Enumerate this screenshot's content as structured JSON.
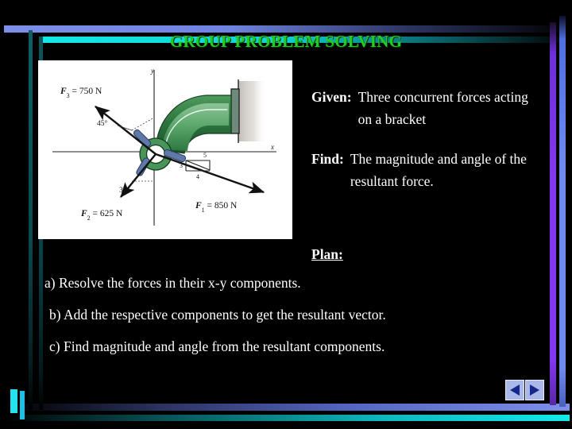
{
  "slide": {
    "title": "GROUP PROBLEM SOLVING",
    "title_color": "#22cc22",
    "background_color": "#000000",
    "text_color": "#ffffff"
  },
  "given": {
    "label": "Given:",
    "text": "Three concurrent forces  acting on a bracket"
  },
  "find": {
    "label": "Find:",
    "text": "The magnitude and angle of the resultant force."
  },
  "plan": {
    "heading": "Plan:",
    "items": [
      "a) Resolve the forces in their x-y components.",
      "b) Add the respective components to get the resultant vector.",
      "c) Find magnitude and angle from the resultant components."
    ]
  },
  "figure": {
    "axis_x_label": "x",
    "axis_y_label": "y",
    "forces": [
      {
        "name": "F_1",
        "label": "F",
        "sub": "1",
        "value": "= 850 N",
        "full": "F₁ = 850 N"
      },
      {
        "name": "F_2",
        "label": "F",
        "sub": "2",
        "value": "= 625 N",
        "full": "F₂ = 625 N"
      },
      {
        "name": "F_3",
        "label": "F",
        "sub": "3",
        "value": "= 750 N",
        "full": "F₃ = 750 N"
      }
    ],
    "angles": [
      "45°",
      "30°"
    ],
    "slope_triangle": {
      "rise": "3",
      "run": "4",
      "hyp": "5"
    },
    "bracket_color": "#3f8a4e"
  },
  "nav": {
    "previous_label": "previous-slide",
    "next_label": "next-slide"
  },
  "frame": {
    "accent_blue": "#7d8fe8",
    "accent_cyan": "#14e8e8",
    "accent_purple": "#8437f0",
    "accent_teal": "#0e5f66"
  }
}
